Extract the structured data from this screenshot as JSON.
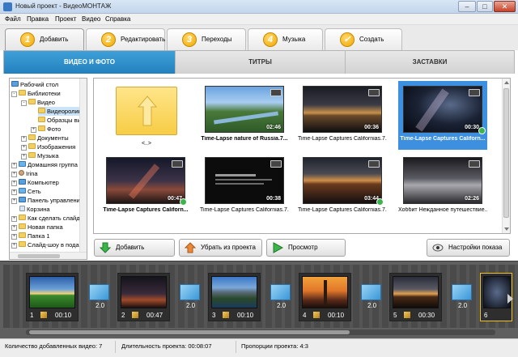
{
  "window": {
    "title": "Новый проект - ВидеоМОНТАЖ",
    "buttons": {
      "minimize": "–",
      "maximize": "□",
      "close": "✕"
    }
  },
  "menu": [
    "Файл",
    "Правка",
    "Проект",
    "Видео",
    "Справка"
  ],
  "steps": [
    {
      "num": "1",
      "label": "Добавить",
      "active": true
    },
    {
      "num": "2",
      "label": "Редактировать"
    },
    {
      "num": "3",
      "label": "Переходы"
    },
    {
      "num": "4",
      "label": "Музыка"
    },
    {
      "num": "✓",
      "label": "Создать"
    }
  ],
  "subtabs": [
    "ВИДЕО И ФОТО",
    "ТИТРЫ",
    "ЗАСТАВКИ"
  ],
  "tree": [
    {
      "label": "Рабочий стол",
      "icon": "monitor-icon"
    },
    {
      "label": "Библиотеки",
      "icon": "folder-icon",
      "expander": "-"
    },
    {
      "label": "Видео",
      "icon": "folder-icon",
      "expander": "-"
    },
    {
      "label": "Видеоролики",
      "icon": "folder-icon",
      "selected": true
    },
    {
      "label": "Образцы видео",
      "icon": "folder-icon"
    },
    {
      "label": "Фото",
      "icon": "folder-icon",
      "expander": "+"
    },
    {
      "label": "Документы",
      "icon": "folder-icon",
      "expander": "+"
    },
    {
      "label": "Изображения",
      "icon": "folder-icon",
      "expander": "+"
    },
    {
      "label": "Музыка",
      "icon": "music-icon",
      "expander": "+"
    },
    {
      "label": "Домашняя группа",
      "icon": "net-icon",
      "expander": "+"
    },
    {
      "label": "Irina",
      "icon": "user-icon",
      "expander": "+"
    },
    {
      "label": "Компьютер",
      "icon": "monitor-icon",
      "expander": "+"
    },
    {
      "label": "Сеть",
      "icon": "net-icon",
      "expander": "+"
    },
    {
      "label": "Панель управления",
      "icon": "monitor-icon",
      "expander": "+"
    },
    {
      "label": "Корзина",
      "icon": "trash-icon"
    },
    {
      "label": "Как сделать слайд-шоу",
      "icon": "folder-icon",
      "expander": "+"
    },
    {
      "label": "Новая папка",
      "icon": "folder-icon",
      "expander": "+"
    },
    {
      "label": "Папка 1",
      "icon": "folder-icon",
      "expander": "+"
    },
    {
      "label": "Слайд-шоу в подарок",
      "icon": "folder-icon",
      "expander": "+"
    }
  ],
  "up_folder_label": "<..>",
  "files": [
    {
      "caption": "Time-Lapse nature of Russia.7...",
      "duration": "02:46",
      "bold": true
    },
    {
      "caption": "Time-Lapse Captures Californias.7...",
      "duration": "00:36"
    },
    {
      "caption": "Time-Lapse Captures Californ...",
      "duration": "00:30",
      "bold": true,
      "selected": true,
      "added": true
    },
    {
      "caption": "Time-Lapse Captures Californ...",
      "duration": "00:47",
      "bold": true,
      "added": true
    },
    {
      "caption": "Time-Lapse Captures Californias.7...",
      "duration": "00:38"
    },
    {
      "caption": "Time-Lapse Captures Californias.7...",
      "duration": "03:44",
      "added": true
    },
    {
      "caption": "Хоббит Нежданное путешествие...",
      "duration": "02:26"
    }
  ],
  "actions": {
    "add": "Добавить",
    "remove": "Убрать из проекта",
    "preview": "Просмотр",
    "settings": "Настройки показа"
  },
  "timeline": {
    "items": [
      {
        "num": "1",
        "duration": "00:10"
      },
      {
        "num": "2",
        "duration": "00:47"
      },
      {
        "num": "3",
        "duration": "00:10"
      },
      {
        "num": "4",
        "duration": "00:10"
      },
      {
        "num": "5",
        "duration": "00:30"
      },
      {
        "num": "6",
        "duration": ""
      }
    ],
    "transition": "2.0"
  },
  "status": {
    "count": "Количество добавленных видео: 7",
    "length": "Длительность проекта: 00:08:07",
    "ratio": "Пропорции проекта: 4:3"
  }
}
